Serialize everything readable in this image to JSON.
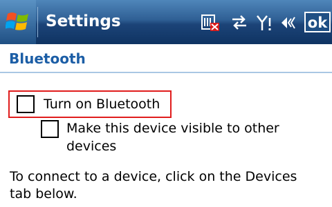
{
  "titlebar": {
    "title": "Settings",
    "start_icon": "windows-flag-icon",
    "status_icons": [
      "sim-missing-icon",
      "connectivity-icon",
      "signal-icon",
      "volume-icon"
    ],
    "ok_label": "ok"
  },
  "page": {
    "header": "Bluetooth"
  },
  "options": {
    "turn_on_bluetooth": {
      "label": "Turn on Bluetooth",
      "checked": false
    },
    "visible_device": {
      "label_line1": "Make this device visible to other",
      "label_line2": "devices",
      "checked": false
    }
  },
  "info": {
    "text_line1": "To connect to a device, click on the Devices",
    "text_line2": "tab below."
  },
  "colors": {
    "titlebar": "#1c4478",
    "header_text": "#1c5ea6",
    "focus_border": "#e01c1c"
  }
}
